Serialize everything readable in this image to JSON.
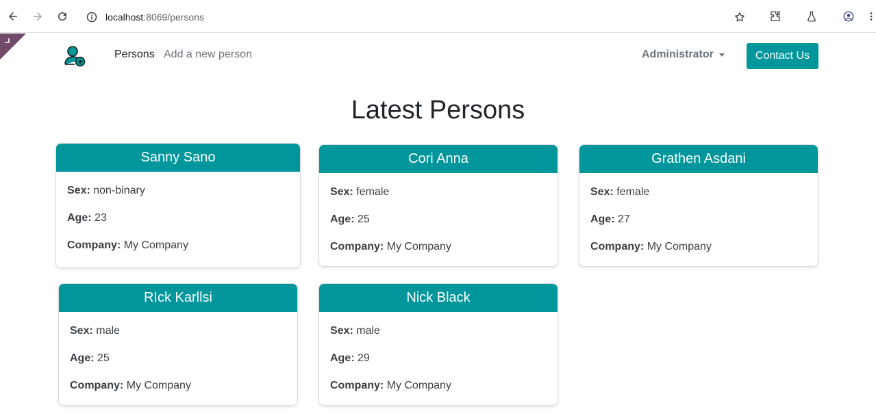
{
  "browser": {
    "url_host": "localhost",
    "url_path": ":8069/persons",
    "icons": [
      "back-icon",
      "forward-icon",
      "reload-icon",
      "info-icon",
      "star-icon",
      "extensions-icon",
      "labs-icon",
      "profile-icon",
      "menu-icon"
    ]
  },
  "header": {
    "nav": {
      "persons": "Persons",
      "add_person": "Add a new person"
    },
    "user_menu": "Administrator",
    "contact_button": "Contact Us",
    "accent_color": "#00969b"
  },
  "main": {
    "title": "Latest Persons",
    "labels": {
      "sex": "Sex:",
      "age": "Age:",
      "company": "Company:"
    },
    "persons": [
      {
        "name": "Sanny Sano",
        "sex": "non-binary",
        "age": "23",
        "company": "My Company"
      },
      {
        "name": "Cori Anna",
        "sex": "female",
        "age": "25",
        "company": "My Company"
      },
      {
        "name": "Grathen Asdani",
        "sex": "female",
        "age": "27",
        "company": "My Company"
      },
      {
        "name": "RIck Karllsi",
        "sex": "male",
        "age": "25",
        "company": "My Company"
      },
      {
        "name": "Nick Black",
        "sex": "male",
        "age": "29",
        "company": "My Company"
      }
    ]
  }
}
